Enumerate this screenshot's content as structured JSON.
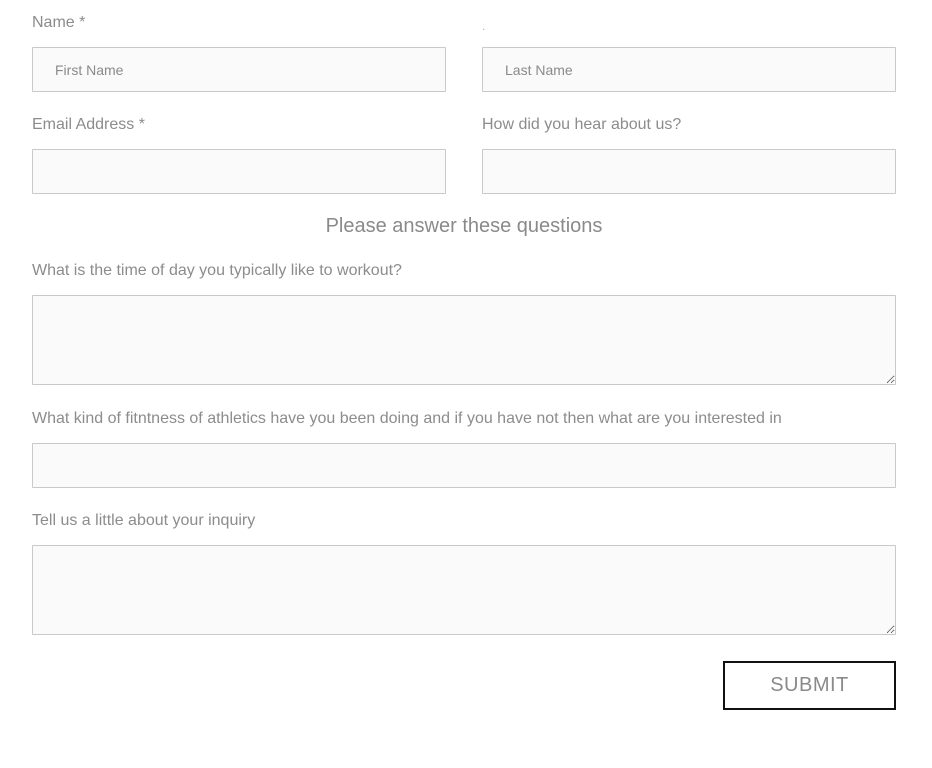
{
  "form": {
    "name_label": "Name *",
    "last_name_label": ".",
    "first_name_placeholder": "First Name",
    "last_name_placeholder": "Last Name",
    "email_label": "Email Address *",
    "hear_label": "How did you hear about us?",
    "section_heading": "Please answer these questions",
    "workout_time_label": "What is the time of day you typically like to workout?",
    "fitness_label": "What kind of fitntness of athletics have you been doing and if you have not then what are you interested in",
    "inquiry_label": "Tell us a little about your inquiry",
    "submit_label": "SUBMIT"
  }
}
